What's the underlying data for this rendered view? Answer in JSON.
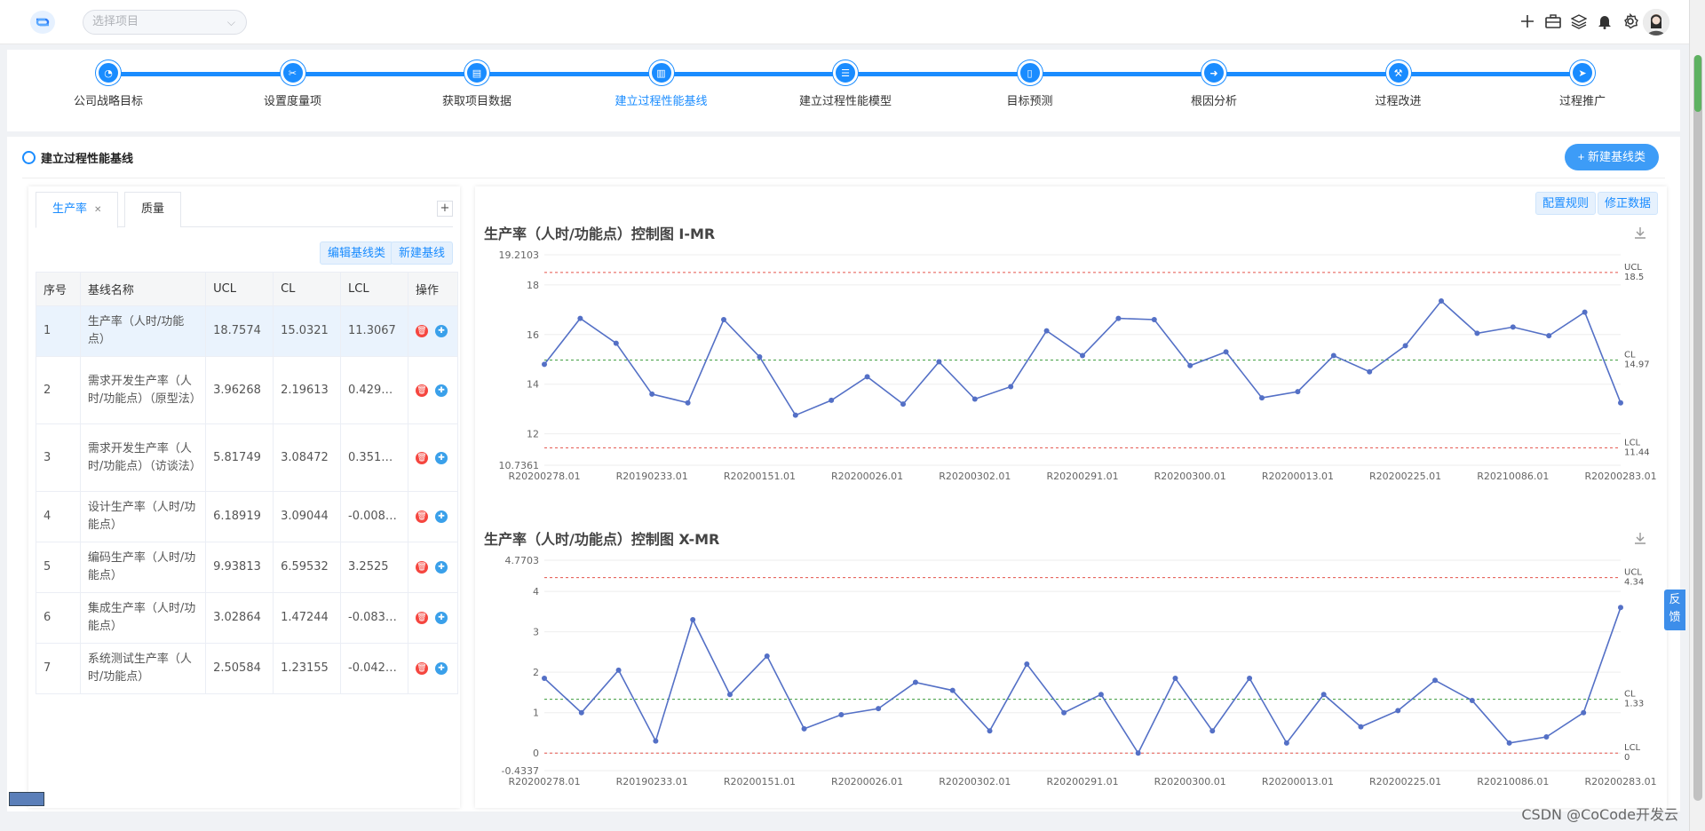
{
  "topbar": {
    "project_placeholder": "选择项目",
    "icons": [
      "plus-icon",
      "briefcase-icon",
      "layers-icon",
      "bell-icon",
      "settings-icon"
    ]
  },
  "steps": [
    {
      "label": "公司战略目标",
      "active": false
    },
    {
      "label": "设置度量项",
      "active": false
    },
    {
      "label": "获取项目数据",
      "active": false
    },
    {
      "label": "建立过程性能基线",
      "active": true
    },
    {
      "label": "建立过程性能模型",
      "active": false
    },
    {
      "label": "目标预测",
      "active": false
    },
    {
      "label": "根因分析",
      "active": false
    },
    {
      "label": "过程改进",
      "active": false
    },
    {
      "label": "过程推广",
      "active": false
    }
  ],
  "section": {
    "title": "建立过程性能基线",
    "new_category_label": "+ 新建基线类"
  },
  "left": {
    "tabs": [
      {
        "label": "生产率",
        "active": true
      },
      {
        "label": "质量",
        "active": false
      }
    ],
    "tab_add": "+",
    "edit_btn": "编辑基线类",
    "new_btn": "新建基线",
    "columns": [
      "序号",
      "基线名称",
      "UCL",
      "CL",
      "LCL",
      "操作"
    ],
    "rows": [
      {
        "idx": "1",
        "name": "生产率（人时/功能点）",
        "ucl": "18.7574",
        "cl": "15.0321",
        "lcl": "11.3067"
      },
      {
        "idx": "2",
        "name": "需求开发生产率（人时/功能点）（原型法）",
        "ucl": "3.96268",
        "cl": "2.19613",
        "lcl": "0.429…"
      },
      {
        "idx": "3",
        "name": "需求开发生产率（人时/功能点）（访谈法）",
        "ucl": "5.81749",
        "cl": "3.08472",
        "lcl": "0.351…"
      },
      {
        "idx": "4",
        "name": "设计生产率（人时/功能点）",
        "ucl": "6.18919",
        "cl": "3.09044",
        "lcl": "-0.008…"
      },
      {
        "idx": "5",
        "name": "编码生产率（人时/功能点）",
        "ucl": "9.93813",
        "cl": "6.59532",
        "lcl": "3.2525"
      },
      {
        "idx": "6",
        "name": "集成生产率（人时/功能点）",
        "ucl": "3.02864",
        "cl": "1.47244",
        "lcl": "-0.083…"
      },
      {
        "idx": "7",
        "name": "系统测试生产率（人时/功能点）",
        "ucl": "2.50584",
        "cl": "1.23155",
        "lcl": "-0.042…"
      }
    ]
  },
  "right": {
    "config_btn": "配置规则",
    "fix_btn": "修正数据"
  },
  "chart_data": [
    {
      "type": "line",
      "title": "生产率（人时/功能点）控制图 I-MR",
      "ylim": [
        10.7361,
        19.2103
      ],
      "yticks": [
        "19.2103",
        "18",
        "16",
        "14",
        "12",
        "10.7361"
      ],
      "xtick_labels": [
        "R20200278.01",
        "R20190233.01",
        "R20200151.01",
        "R20200026.01",
        "R20200302.01",
        "R20200291.01",
        "R20200300.01",
        "R20200013.01",
        "R20200225.01",
        "R20210086.01",
        "R20200283.01"
      ],
      "values": [
        14.8,
        16.65,
        15.65,
        13.6,
        13.25,
        16.6,
        15.1,
        12.75,
        13.35,
        14.3,
        13.2,
        14.9,
        13.4,
        13.9,
        16.15,
        15.15,
        16.65,
        16.6,
        14.75,
        15.3,
        13.45,
        13.7,
        15.15,
        14.5,
        15.55,
        17.35,
        16.05,
        16.3,
        15.95,
        16.9,
        13.25
      ],
      "limits": [
        {
          "name": "UCL",
          "value": 18.5,
          "label": "18.5",
          "color": "#e5534b"
        },
        {
          "name": "CL",
          "value": 14.97,
          "label": "14.97",
          "color": "#3a9b3a"
        },
        {
          "name": "LCL",
          "value": 11.44,
          "label": "11.44",
          "color": "#e5534b"
        }
      ]
    },
    {
      "type": "line",
      "title": "生产率（人时/功能点）控制图 X-MR",
      "ylim": [
        -0.4337,
        4.7703
      ],
      "yticks": [
        "4.7703",
        "4",
        "3",
        "2",
        "1",
        "0",
        "-0.4337"
      ],
      "xtick_labels": [
        "R20200278.01",
        "R20190233.01",
        "R20200151.01",
        "R20200026.01",
        "R20200302.01",
        "R20200291.01",
        "R20200300.01",
        "R20200013.01",
        "R20200225.01",
        "R20210086.01",
        "R20200283.01"
      ],
      "values": [
        1.85,
        1.0,
        2.05,
        0.3,
        3.3,
        1.45,
        2.4,
        0.6,
        0.95,
        1.1,
        1.75,
        1.55,
        0.55,
        2.2,
        1.0,
        1.45,
        0.0,
        1.85,
        0.55,
        1.85,
        0.25,
        1.45,
        0.65,
        1.05,
        1.8,
        1.3,
        0.25,
        0.4,
        1.0,
        3.6
      ],
      "limits": [
        {
          "name": "UCL",
          "value": 4.34,
          "label": "4.34",
          "color": "#e5534b"
        },
        {
          "name": "CL",
          "value": 1.33,
          "label": "1.33",
          "color": "#3a9b3a"
        },
        {
          "name": "LCL",
          "value": 0,
          "label": "0",
          "color": "#e5534b"
        }
      ]
    }
  ],
  "feedback": "反馈",
  "watermark": "CSDN @CoCode开发云"
}
